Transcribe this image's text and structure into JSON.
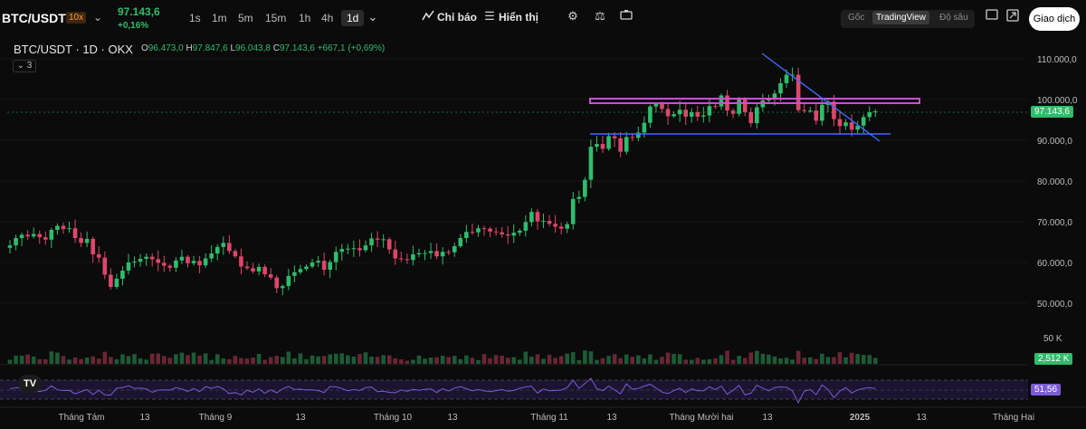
{
  "header": {
    "pair": "BTC/USDT",
    "leverage": "10x",
    "last_price": "97.143,6",
    "change_pct": "+0,16%",
    "timeframes": [
      "1s",
      "1m",
      "5m",
      "15m",
      "1h",
      "4h",
      "1d"
    ],
    "active_timeframe": "1d",
    "indicators_label": "Chỉ báo",
    "display_label": "Hiển thị",
    "view_modes": [
      "Gốc",
      "TradingView",
      "Độ sâu"
    ],
    "active_view": "TradingView",
    "trade_button": "Giao dịch"
  },
  "legend": {
    "symbol": "BTC/USDT · 1D · OKX",
    "o_label": "O",
    "o": "96.473,0",
    "h_label": "H",
    "h": "97.847,6",
    "l_label": "L",
    "l": "96.043,8",
    "c_label": "C",
    "c": "97.143,6",
    "change": "+667,1 (+0,69%)",
    "indicator_count": "3"
  },
  "colors": {
    "up": "#2ebd6b",
    "down": "#e0456b",
    "trendline": "#3f6bff",
    "resistance_box": "#c94fd6",
    "rsi": "#7b5cd6",
    "background": "#0b0b0b"
  },
  "chart_data": {
    "type": "candlestick",
    "y_ticks": [
      "110.000,0",
      "100.000,0",
      "90.000,0",
      "80.000,0",
      "70.000,0",
      "60.000,0",
      "50.000,0"
    ],
    "y_tick_values": [
      110000,
      100000,
      90000,
      80000,
      70000,
      60000,
      50000
    ],
    "ylim": [
      43000,
      116000
    ],
    "x_ticks": [
      "Tháng Tám",
      "13",
      "Tháng 9",
      "13",
      "Tháng 10",
      "13",
      "Tháng 11",
      "13",
      "Tháng Mười hai",
      "13",
      "2025",
      "13",
      "Tháng Hai"
    ],
    "last_price_label": "97.143,6",
    "volume_label": "50 K",
    "volume_last_label": "2,512 K",
    "rsi_label": "51,56",
    "closes": [
      64200,
      66000,
      66800,
      66400,
      67000,
      66200,
      65600,
      68000,
      69000,
      68200,
      68400,
      66000,
      64800,
      65800,
      62000,
      61200,
      57000,
      54000,
      56000,
      58000,
      60000,
      60200,
      60900,
      61400,
      60800,
      59900,
      59200,
      58700,
      60500,
      61400,
      59800,
      60400,
      59300,
      61000,
      62200,
      63800,
      64800,
      62800,
      61500,
      59000,
      58600,
      57800,
      58900,
      57100,
      56300,
      53700,
      54200,
      56700,
      57600,
      58400,
      59000,
      60000,
      60400,
      58200,
      60100,
      62600,
      63300,
      63400,
      63500,
      63000,
      64200,
      65900,
      65600,
      65700,
      63200,
      61000,
      60800,
      60600,
      62000,
      62300,
      62300,
      62800,
      61500,
      62600,
      62500,
      64000,
      66000,
      67500,
      67400,
      68400,
      68300,
      67600,
      67400,
      66900,
      66600,
      67300,
      67800,
      69900,
      72400,
      70100,
      70200,
      69500,
      68800,
      68300,
      69400,
      75600,
      76100,
      80300,
      88400,
      89100,
      87900,
      91000,
      90500,
      87200,
      90800,
      90600,
      91900,
      94300,
      98300,
      98900,
      97700,
      95900,
      96400,
      97500,
      95800,
      96900,
      95800,
      96100,
      98400,
      98300,
      101000,
      97300,
      96500,
      100000,
      96900,
      94200,
      98100,
      99800,
      100000,
      101500,
      104000,
      106100,
      106100,
      97400,
      97200,
      97300,
      94800,
      98700,
      99500,
      95200,
      93500,
      94400,
      92600,
      93600,
      95700,
      96900,
      97100
    ]
  }
}
